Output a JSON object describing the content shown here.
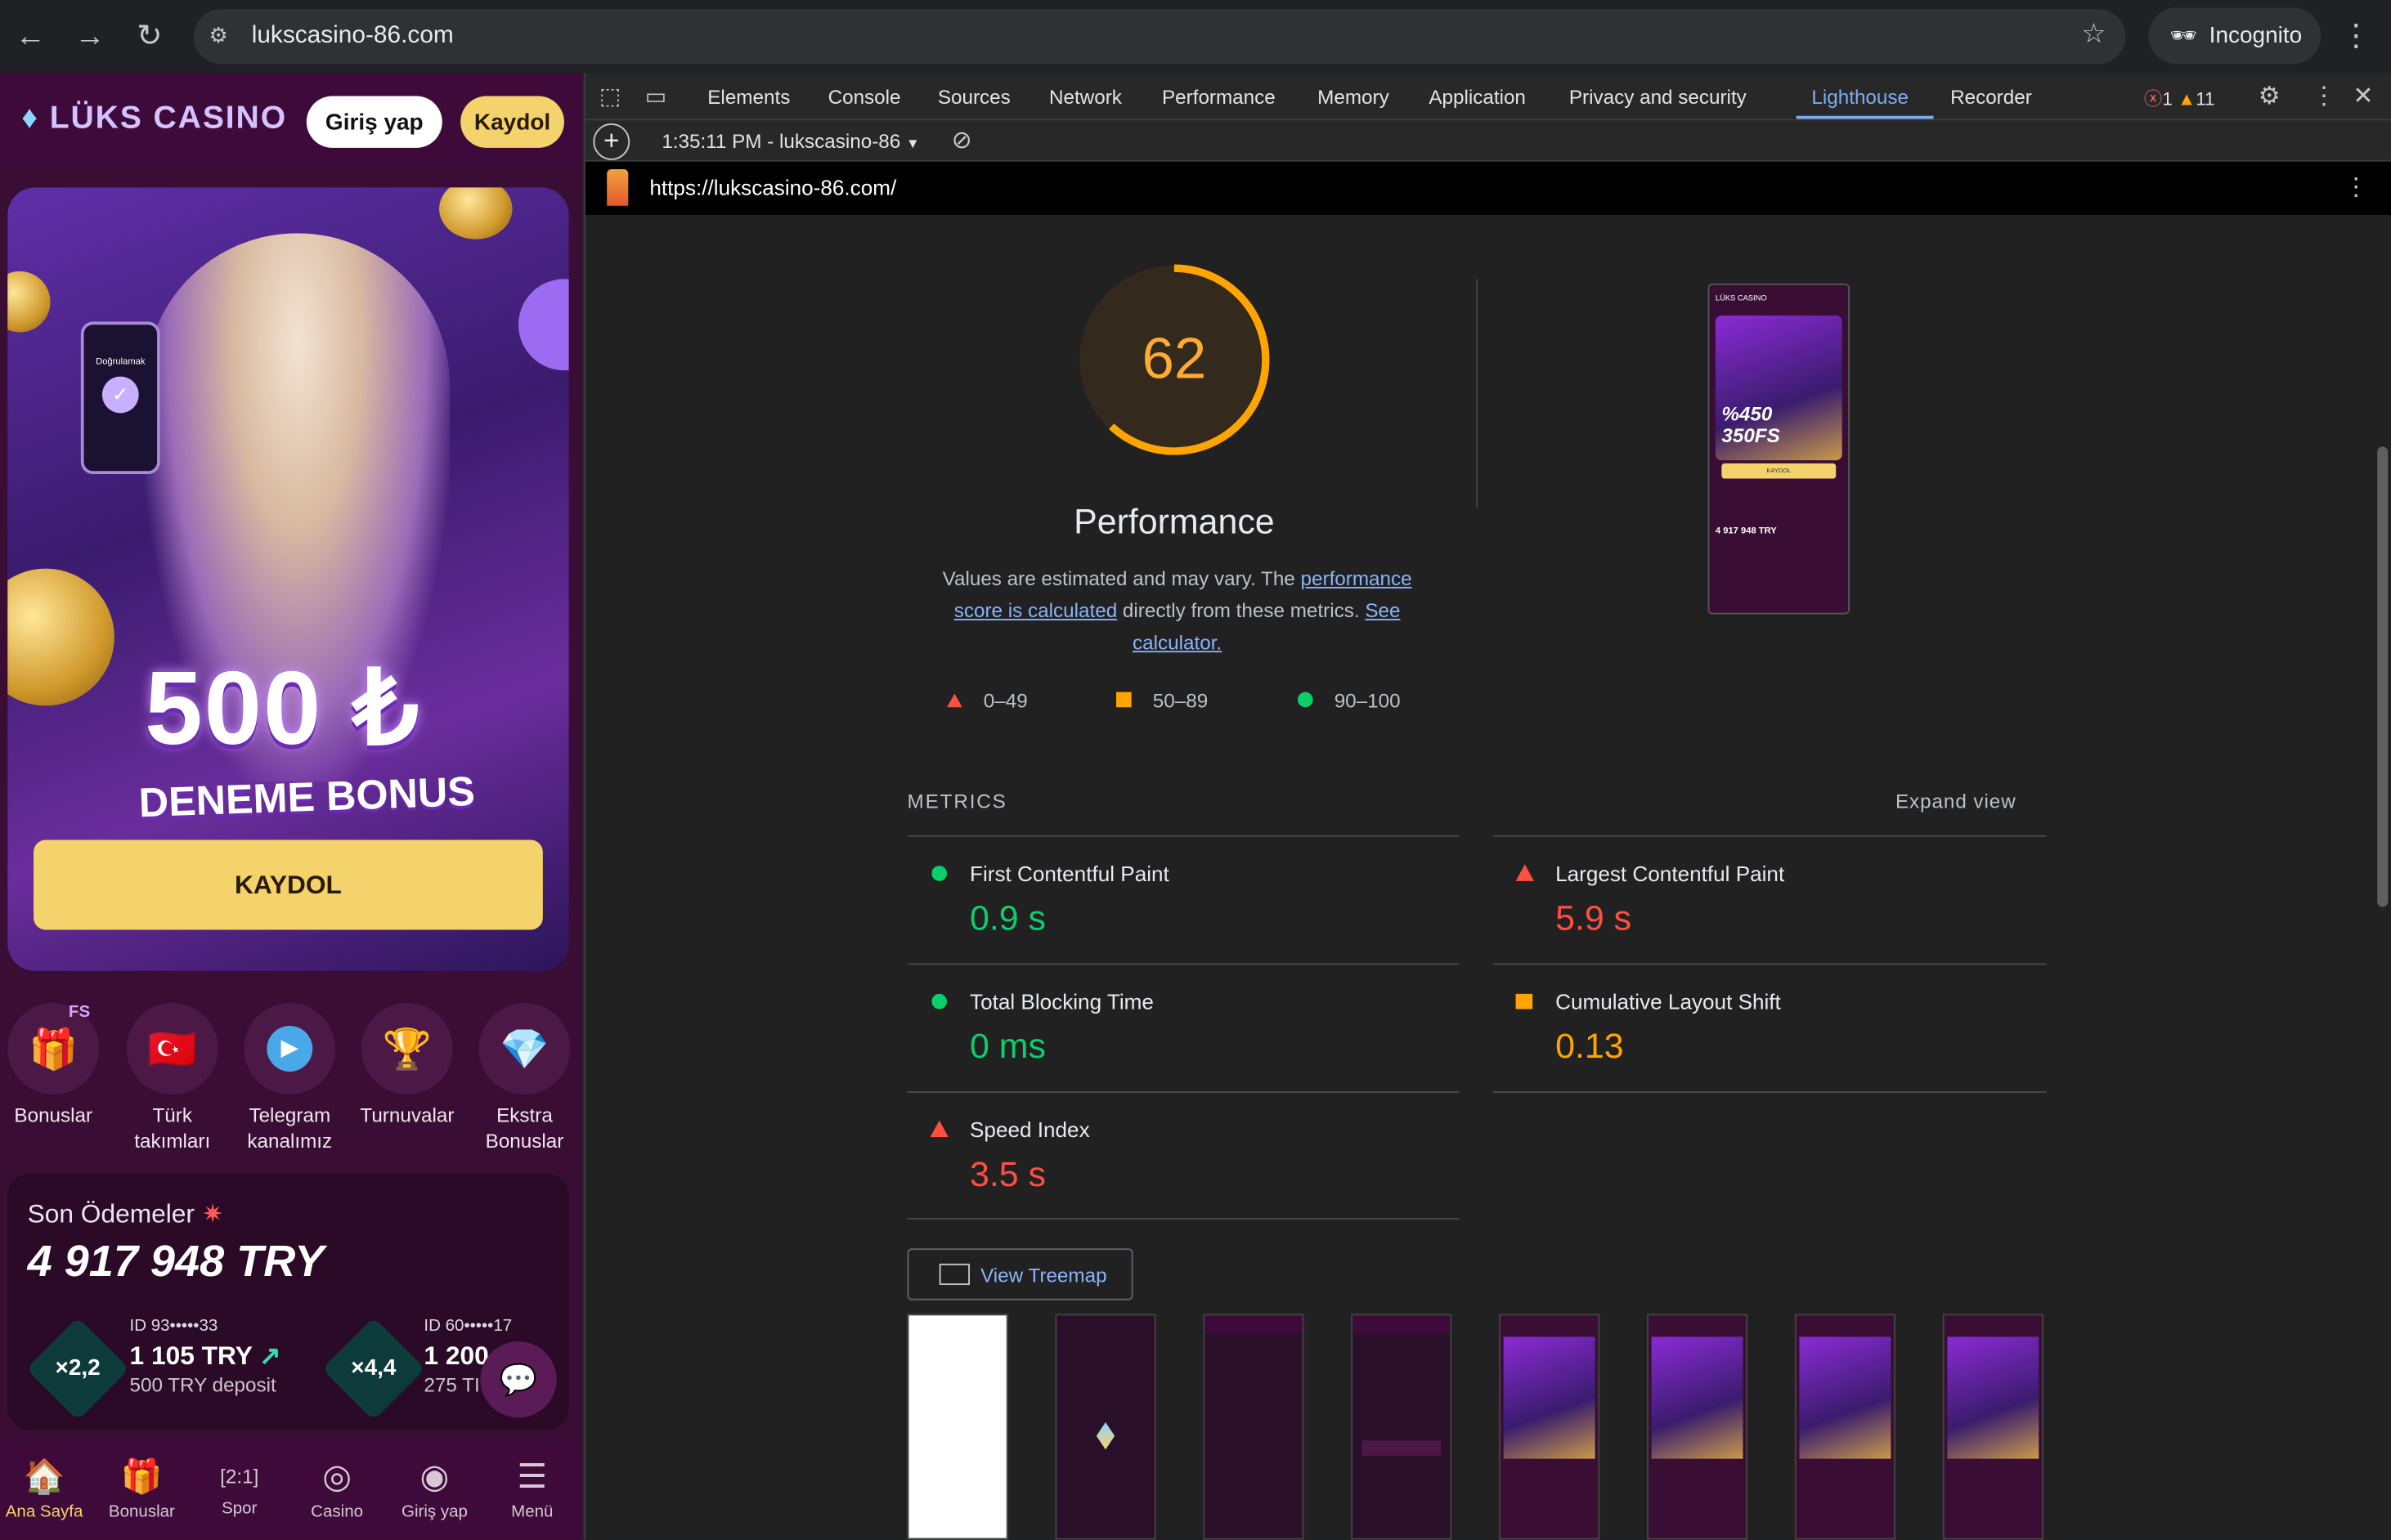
{
  "browser": {
    "url": "lukscasino-86.com",
    "incognito_label": "Incognito"
  },
  "site": {
    "logo": "LÜKS CASINO",
    "login_label": "Giriş yap",
    "register_label": "Kaydol",
    "hero": {
      "phone_label": "Doğrulamak",
      "amount": "500 ₺",
      "subtitle": "DENEME BONUS",
      "cta": "KAYDOL"
    },
    "categories": [
      {
        "label": "Bonuslar",
        "badge": "FS"
      },
      {
        "label": "Türk takımları"
      },
      {
        "label": "Telegram kanalımız"
      },
      {
        "label": "Turnuvalar"
      },
      {
        "label": "Ekstra Bonuslar"
      }
    ],
    "payments": {
      "title": "Son Ödemeler",
      "total": "4 917 948 TRY",
      "items": [
        {
          "multiplier": "×2,2",
          "id": "ID 93•••••33",
          "amount": "1 105 TRY",
          "sub": "500 TRY deposit"
        },
        {
          "multiplier": "×4,4",
          "id": "ID 60•••••17",
          "amount": "1 200",
          "sub": "275 TI"
        }
      ]
    },
    "bottom_nav": [
      {
        "label": "Ana Sayfa",
        "icon": "home-icon"
      },
      {
        "label": "Bonuslar",
        "icon": "gift-icon"
      },
      {
        "label": "Spor",
        "icon": "score-icon"
      },
      {
        "label": "Casino",
        "icon": "chip-icon"
      },
      {
        "label": "Giriş yap",
        "icon": "user-icon"
      },
      {
        "label": "Menü",
        "icon": "menu-icon"
      }
    ]
  },
  "devtools": {
    "tabs": [
      "Elements",
      "Console",
      "Sources",
      "Network",
      "Performance",
      "Memory",
      "Application",
      "Privacy and security",
      "Lighthouse",
      "Recorder"
    ],
    "active_tab": "Lighthouse",
    "errors": "1",
    "warnings": "11",
    "report_selector": "1:35:11 PM - lukscasino-86",
    "report_url": "https://lukscasino-86.com/",
    "score": "62",
    "score_fraction": 0.62,
    "category": "Performance",
    "desc_pre": "Values are estimated and may vary. The ",
    "desc_link1": "performance score is calculated",
    "desc_mid": " directly from these metrics. ",
    "desc_link2": "See calculator.",
    "legend": [
      "0–49",
      "50–89",
      "90–100"
    ],
    "metrics_label": "METRICS",
    "expand_label": "Expand view",
    "metrics": [
      {
        "name": "First Contentful Paint",
        "value": "0.9 s",
        "rating": "pass"
      },
      {
        "name": "Largest Contentful Paint",
        "value": "5.9 s",
        "rating": "fail"
      },
      {
        "name": "Total Blocking Time",
        "value": "0 ms",
        "rating": "pass"
      },
      {
        "name": "Cumulative Layout Shift",
        "value": "0.13",
        "rating": "average"
      },
      {
        "name": "Speed Index",
        "value": "3.5 s",
        "rating": "fail"
      }
    ],
    "treemap_label": "View Treemap",
    "thumb": {
      "logo": "LÜKS CASINO",
      "promo": "%450 350FS",
      "cta": "KAYDOL",
      "total": "4 917 948 TRY"
    },
    "colors": {
      "pass": "#0cce6b",
      "average": "#ffa400",
      "fail": "#ff4e42",
      "accent": "#7cacf8"
    }
  }
}
